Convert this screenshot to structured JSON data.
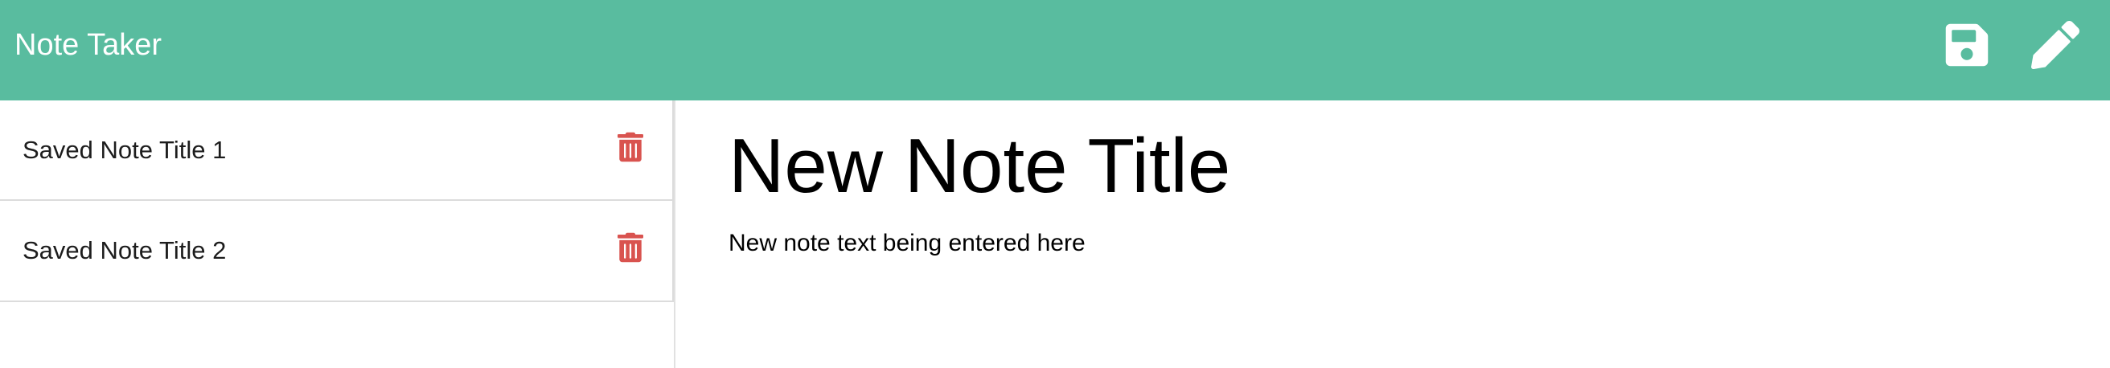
{
  "app": {
    "title": "Note Taker"
  },
  "toolbar": {
    "save_icon": "floppy-disk-icon",
    "edit_icon": "pencil-icon"
  },
  "sidebar": {
    "notes": [
      {
        "title": "Saved Note Title 1",
        "delete_icon": "trash-icon"
      },
      {
        "title": "Saved Note Title 2",
        "delete_icon": "trash-icon"
      }
    ]
  },
  "editor": {
    "title_value": "New Note Title",
    "text_value": "New note text being entered here"
  },
  "colors": {
    "navbar": "#59bc9f",
    "delete": "#d9534f",
    "text": "#000000"
  }
}
